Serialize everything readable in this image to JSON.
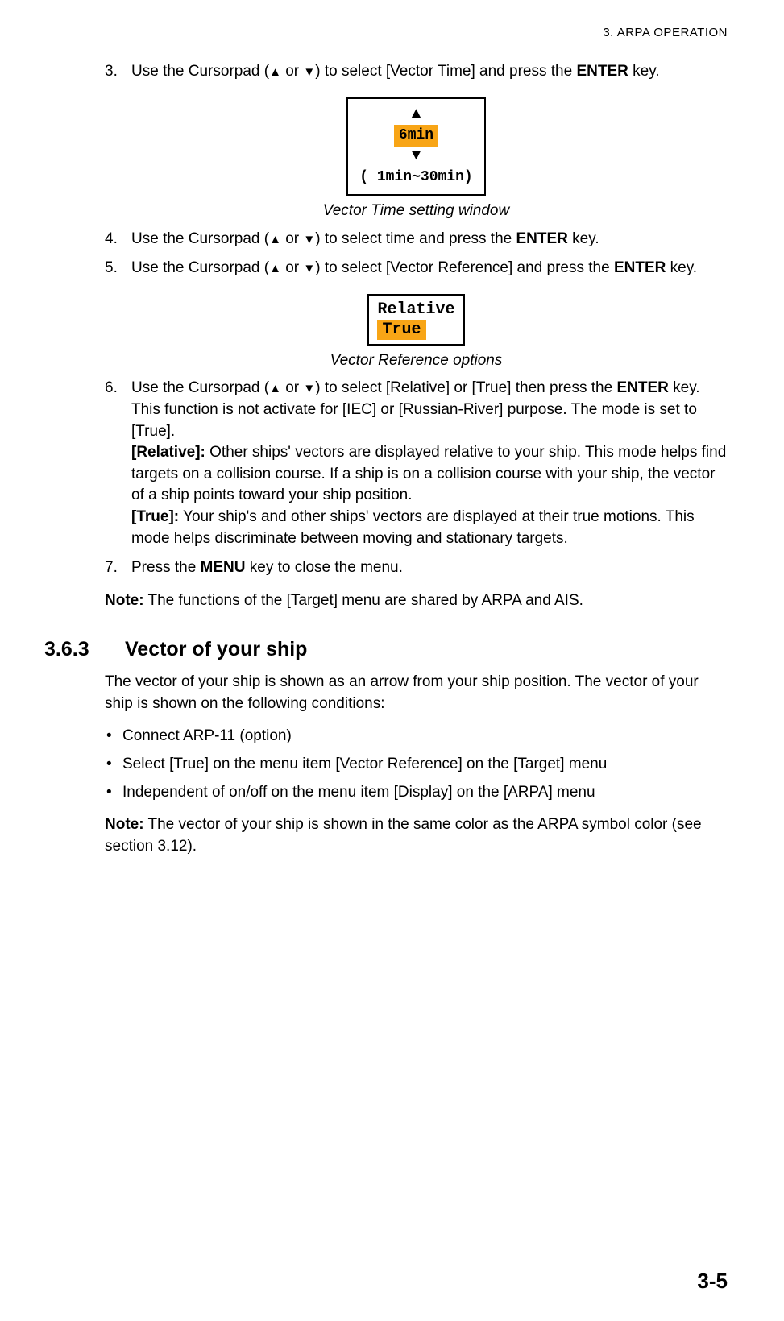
{
  "header": {
    "chapter": "3.  ARPA OPERATION"
  },
  "steps": {
    "s3": {
      "num": "3.",
      "pre": "Use the Cursorpad (",
      "mid": " or ",
      "post": ") to select [Vector Time] and press the ",
      "key": "ENTER",
      "tail": " key."
    },
    "fig1": {
      "value": "6min",
      "range": "( 1min∼30min)",
      "caption": "Vector Time setting window"
    },
    "s4": {
      "num": "4.",
      "pre": "Use the Cursorpad (",
      "mid": " or ",
      "post": ") to select time and press the ",
      "key": "ENTER",
      "tail": " key."
    },
    "s5": {
      "num": "5.",
      "pre": "Use the Cursorpad (",
      "mid": " or ",
      "post": ") to select [Vector Reference] and press the ",
      "key": "ENTER",
      "tail": " key."
    },
    "fig2": {
      "opt1": "Relative",
      "opt2": "True",
      "caption": "Vector Reference options"
    },
    "s6": {
      "num": "6.",
      "pre": "Use the Cursorpad (",
      "mid": " or ",
      "post": ") to select [Relative] or [True] then press the ",
      "key": "ENTER",
      "tail": " key. This function is not activate for [IEC] or [Russian-River] purpose. The mode is set to [True].",
      "rel_label": "[Relative]:",
      "rel_text": " Other ships' vectors are displayed relative to your ship. This mode helps find targets on a collision course. If a ship is on a collision course with your ship, the vector of a ship points toward your ship position.",
      "true_label": "[True]:",
      "true_text": " Your ship's and other ships' vectors are displayed at their true motions. This mode helps discriminate between moving and stationary targets."
    },
    "s7": {
      "num": "7.",
      "pre": "Press the ",
      "key": "MENU",
      "tail": " key to close the menu."
    }
  },
  "note1": {
    "label": "Note:",
    "text": " The functions of the [Target] menu are shared by ARPA and AIS."
  },
  "section": {
    "num": "3.6.3",
    "title": "Vector of your ship",
    "p1": "The vector of your ship is shown as an arrow from your ship position. The vector of your ship is shown on the following conditions:",
    "bullets": {
      "b1": "Connect ARP-11 (option)",
      "b2": "Select [True] on the menu item [Vector Reference] on the [Target] menu",
      "b3": "Independent of on/off on the menu item [Display] on the [ARPA] menu"
    },
    "note2": {
      "label": "Note:",
      "text": " The vector of your ship is shown in the same color as the ARPA symbol color (see section 3.12)."
    }
  },
  "page": "3-5"
}
